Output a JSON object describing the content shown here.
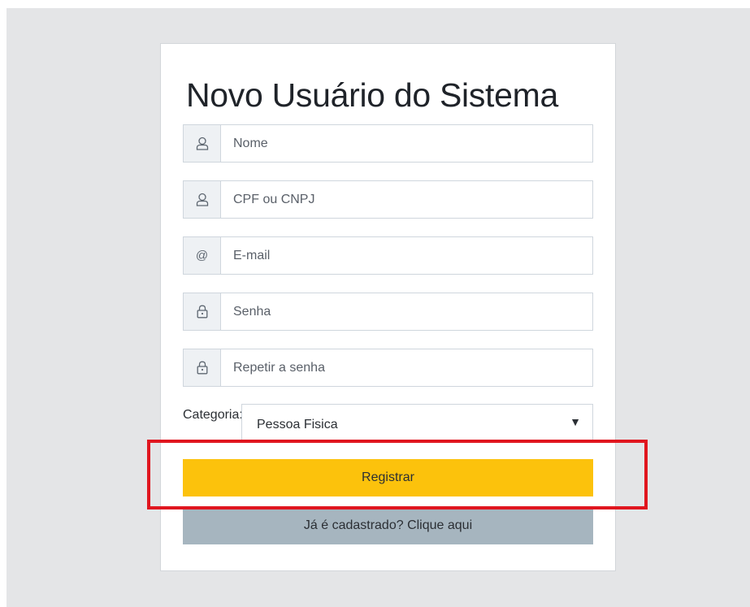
{
  "form": {
    "title": "Novo Usuário do Sistema",
    "fields": [
      {
        "placeholder": "Nome",
        "icon": "user-icon"
      },
      {
        "placeholder": "CPF ou CNPJ",
        "icon": "user-icon"
      },
      {
        "placeholder": "E-mail",
        "icon": "at-icon",
        "symbol": "@"
      },
      {
        "placeholder": "Senha",
        "icon": "lock-icon"
      },
      {
        "placeholder": "Repetir a senha",
        "icon": "lock-icon"
      }
    ],
    "category": {
      "label": "Categoria:",
      "selected": "Pessoa Fisica",
      "arrow": "▼"
    },
    "register_label": "Registrar",
    "login_label": "Já é cadastrado? Clique aqui"
  },
  "colors": {
    "register_button": "#fcc20c",
    "login_button": "#a6b5bf",
    "highlight_box": "#e0161f",
    "backdrop": "#e4e5e7"
  }
}
